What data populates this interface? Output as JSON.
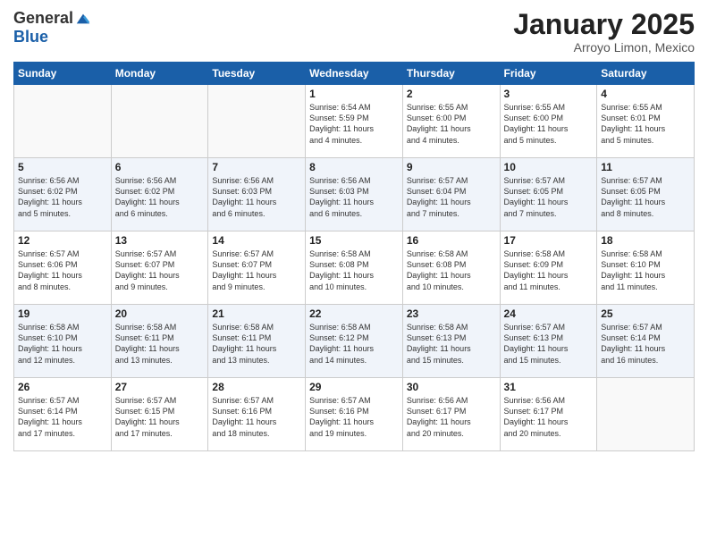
{
  "logo": {
    "general": "General",
    "blue": "Blue"
  },
  "title": "January 2025",
  "location": "Arroyo Limon, Mexico",
  "weekdays": [
    "Sunday",
    "Monday",
    "Tuesday",
    "Wednesday",
    "Thursday",
    "Friday",
    "Saturday"
  ],
  "weeks": [
    [
      {
        "day": "",
        "info": ""
      },
      {
        "day": "",
        "info": ""
      },
      {
        "day": "",
        "info": ""
      },
      {
        "day": "1",
        "info": "Sunrise: 6:54 AM\nSunset: 5:59 PM\nDaylight: 11 hours\nand 4 minutes."
      },
      {
        "day": "2",
        "info": "Sunrise: 6:55 AM\nSunset: 6:00 PM\nDaylight: 11 hours\nand 4 minutes."
      },
      {
        "day": "3",
        "info": "Sunrise: 6:55 AM\nSunset: 6:00 PM\nDaylight: 11 hours\nand 5 minutes."
      },
      {
        "day": "4",
        "info": "Sunrise: 6:55 AM\nSunset: 6:01 PM\nDaylight: 11 hours\nand 5 minutes."
      }
    ],
    [
      {
        "day": "5",
        "info": "Sunrise: 6:56 AM\nSunset: 6:02 PM\nDaylight: 11 hours\nand 5 minutes."
      },
      {
        "day": "6",
        "info": "Sunrise: 6:56 AM\nSunset: 6:02 PM\nDaylight: 11 hours\nand 6 minutes."
      },
      {
        "day": "7",
        "info": "Sunrise: 6:56 AM\nSunset: 6:03 PM\nDaylight: 11 hours\nand 6 minutes."
      },
      {
        "day": "8",
        "info": "Sunrise: 6:56 AM\nSunset: 6:03 PM\nDaylight: 11 hours\nand 6 minutes."
      },
      {
        "day": "9",
        "info": "Sunrise: 6:57 AM\nSunset: 6:04 PM\nDaylight: 11 hours\nand 7 minutes."
      },
      {
        "day": "10",
        "info": "Sunrise: 6:57 AM\nSunset: 6:05 PM\nDaylight: 11 hours\nand 7 minutes."
      },
      {
        "day": "11",
        "info": "Sunrise: 6:57 AM\nSunset: 6:05 PM\nDaylight: 11 hours\nand 8 minutes."
      }
    ],
    [
      {
        "day": "12",
        "info": "Sunrise: 6:57 AM\nSunset: 6:06 PM\nDaylight: 11 hours\nand 8 minutes."
      },
      {
        "day": "13",
        "info": "Sunrise: 6:57 AM\nSunset: 6:07 PM\nDaylight: 11 hours\nand 9 minutes."
      },
      {
        "day": "14",
        "info": "Sunrise: 6:57 AM\nSunset: 6:07 PM\nDaylight: 11 hours\nand 9 minutes."
      },
      {
        "day": "15",
        "info": "Sunrise: 6:58 AM\nSunset: 6:08 PM\nDaylight: 11 hours\nand 10 minutes."
      },
      {
        "day": "16",
        "info": "Sunrise: 6:58 AM\nSunset: 6:08 PM\nDaylight: 11 hours\nand 10 minutes."
      },
      {
        "day": "17",
        "info": "Sunrise: 6:58 AM\nSunset: 6:09 PM\nDaylight: 11 hours\nand 11 minutes."
      },
      {
        "day": "18",
        "info": "Sunrise: 6:58 AM\nSunset: 6:10 PM\nDaylight: 11 hours\nand 11 minutes."
      }
    ],
    [
      {
        "day": "19",
        "info": "Sunrise: 6:58 AM\nSunset: 6:10 PM\nDaylight: 11 hours\nand 12 minutes."
      },
      {
        "day": "20",
        "info": "Sunrise: 6:58 AM\nSunset: 6:11 PM\nDaylight: 11 hours\nand 13 minutes."
      },
      {
        "day": "21",
        "info": "Sunrise: 6:58 AM\nSunset: 6:11 PM\nDaylight: 11 hours\nand 13 minutes."
      },
      {
        "day": "22",
        "info": "Sunrise: 6:58 AM\nSunset: 6:12 PM\nDaylight: 11 hours\nand 14 minutes."
      },
      {
        "day": "23",
        "info": "Sunrise: 6:58 AM\nSunset: 6:13 PM\nDaylight: 11 hours\nand 15 minutes."
      },
      {
        "day": "24",
        "info": "Sunrise: 6:57 AM\nSunset: 6:13 PM\nDaylight: 11 hours\nand 15 minutes."
      },
      {
        "day": "25",
        "info": "Sunrise: 6:57 AM\nSunset: 6:14 PM\nDaylight: 11 hours\nand 16 minutes."
      }
    ],
    [
      {
        "day": "26",
        "info": "Sunrise: 6:57 AM\nSunset: 6:14 PM\nDaylight: 11 hours\nand 17 minutes."
      },
      {
        "day": "27",
        "info": "Sunrise: 6:57 AM\nSunset: 6:15 PM\nDaylight: 11 hours\nand 17 minutes."
      },
      {
        "day": "28",
        "info": "Sunrise: 6:57 AM\nSunset: 6:16 PM\nDaylight: 11 hours\nand 18 minutes."
      },
      {
        "day": "29",
        "info": "Sunrise: 6:57 AM\nSunset: 6:16 PM\nDaylight: 11 hours\nand 19 minutes."
      },
      {
        "day": "30",
        "info": "Sunrise: 6:56 AM\nSunset: 6:17 PM\nDaylight: 11 hours\nand 20 minutes."
      },
      {
        "day": "31",
        "info": "Sunrise: 6:56 AM\nSunset: 6:17 PM\nDaylight: 11 hours\nand 20 minutes."
      },
      {
        "day": "",
        "info": ""
      }
    ]
  ]
}
